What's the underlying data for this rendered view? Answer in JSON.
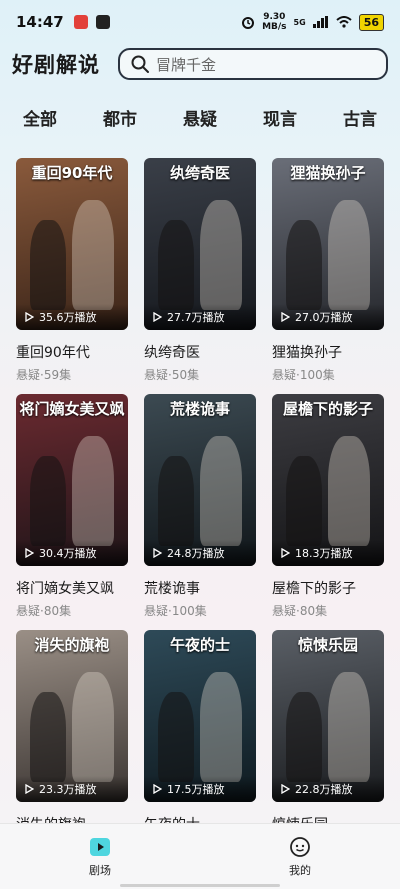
{
  "status_bar": {
    "time": "14:47",
    "net_speed_value": "9.30",
    "net_speed_unit": "MB/s",
    "network": "5G",
    "battery": "56"
  },
  "header": {
    "title": "好剧解说",
    "search_placeholder": "冒牌千金"
  },
  "tabs": [
    "全部",
    "都市",
    "悬疑",
    "现言",
    "古言"
  ],
  "dramas": [
    {
      "poster_title": "重回90年代",
      "plays": "35.6万播放",
      "title": "重回90年代",
      "meta": "悬疑·59集",
      "bg": "#8a5a3c",
      "bg2": "#3a2418"
    },
    {
      "poster_title": "纨绔奇医",
      "plays": "27.7万播放",
      "title": "纨绔奇医",
      "meta": "悬疑·50集",
      "bg": "#3a3f48",
      "bg2": "#15181d"
    },
    {
      "poster_title": "狸猫换孙子",
      "plays": "27.0万播放",
      "title": "狸猫换孙子",
      "meta": "悬疑·100集",
      "bg": "#6a6e78",
      "bg2": "#25272c"
    },
    {
      "poster_title": "将门嫡女美又飒",
      "plays": "30.4万播放",
      "title": "将门嫡女美又飒",
      "meta": "悬疑·80集",
      "bg": "#6b2a30",
      "bg2": "#1e1418"
    },
    {
      "poster_title": "荒楼诡事",
      "plays": "24.8万播放",
      "title": "荒楼诡事",
      "meta": "悬疑·100集",
      "bg": "#3c4a52",
      "bg2": "#10161a"
    },
    {
      "poster_title": "屋檐下的影子",
      "plays": "18.3万播放",
      "title": "屋檐下的影子",
      "meta": "悬疑·80集",
      "bg": "#3d3d42",
      "bg2": "#141416"
    },
    {
      "poster_title": "消失的旗袍",
      "plays": "23.3万播放",
      "title": "消失的旗袍",
      "meta": "",
      "bg": "#9a8f86",
      "bg2": "#3b3532"
    },
    {
      "poster_title": "午夜的士",
      "plays": "17.5万播放",
      "title": "午夜的士",
      "meta": "",
      "bg": "#2e4a58",
      "bg2": "#0f1a20"
    },
    {
      "poster_title": "惊悚乐园",
      "plays": "22.8万播放",
      "title": "惊悚乐园",
      "meta": "",
      "bg": "#5a5f66",
      "bg2": "#1a1c1f"
    }
  ],
  "bottom_nav": [
    {
      "label": "剧场",
      "icon": "theater-play-icon"
    },
    {
      "label": "我的",
      "icon": "profile-face-icon"
    }
  ]
}
